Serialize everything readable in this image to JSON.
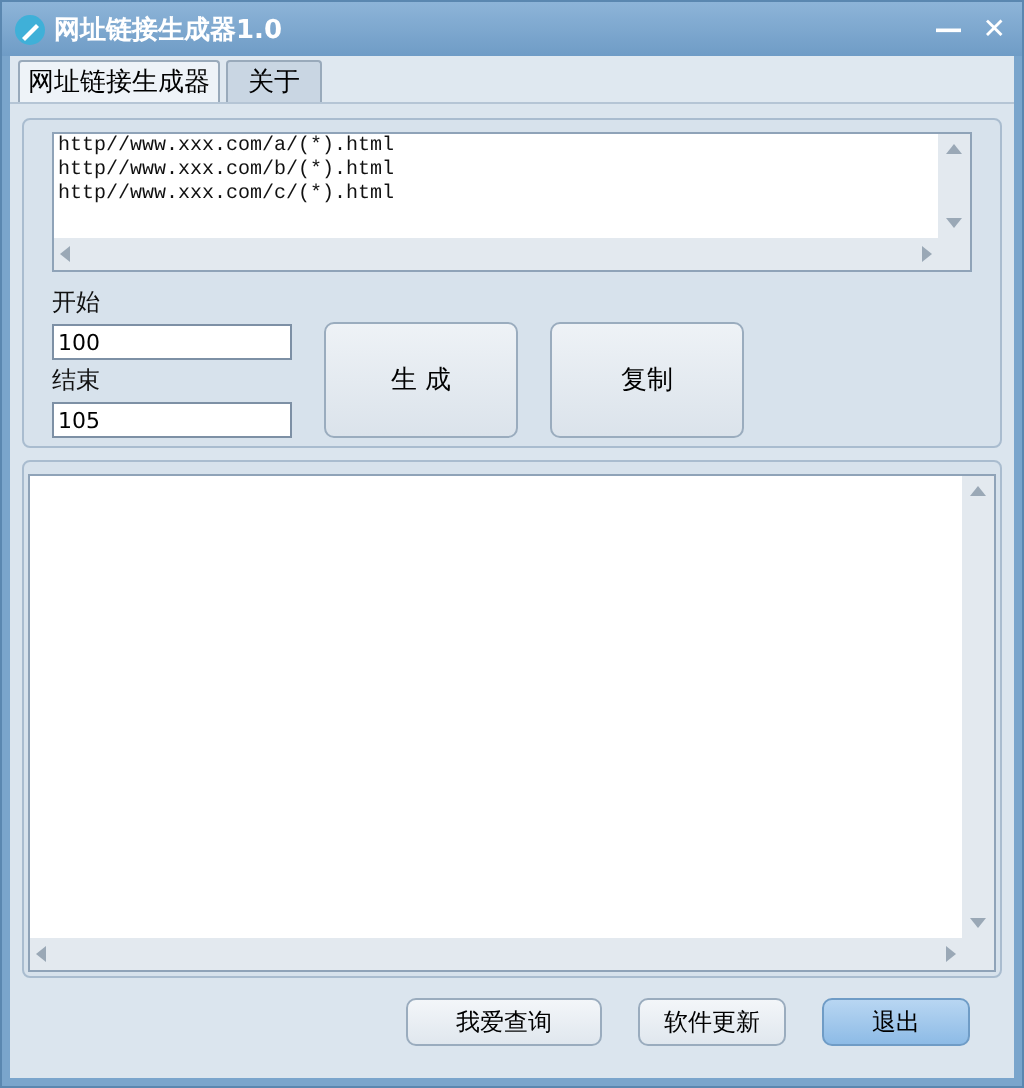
{
  "window": {
    "title": "网址链接生成器1.0",
    "controls": [
      "—",
      "✕"
    ]
  },
  "tabs": [
    {
      "label": "网址链接生成器",
      "selected": true
    },
    {
      "label": "关于",
      "selected": false
    }
  ],
  "url_template": [
    "http//www.xxx.com/a/(*).html",
    "http//www.xxx.com/b/(*).html",
    "http//www.xxx.com/c/(*).html"
  ],
  "start": {
    "label": "开始",
    "value": "100"
  },
  "end": {
    "label": "结束",
    "value": "105"
  },
  "actions": [
    "生 成",
    "复制"
  ],
  "buttons": [
    {
      "label": "我爱查询",
      "default": false
    },
    {
      "label": "软件更新",
      "default": false
    },
    {
      "label": "退出",
      "default": true
    }
  ]
}
